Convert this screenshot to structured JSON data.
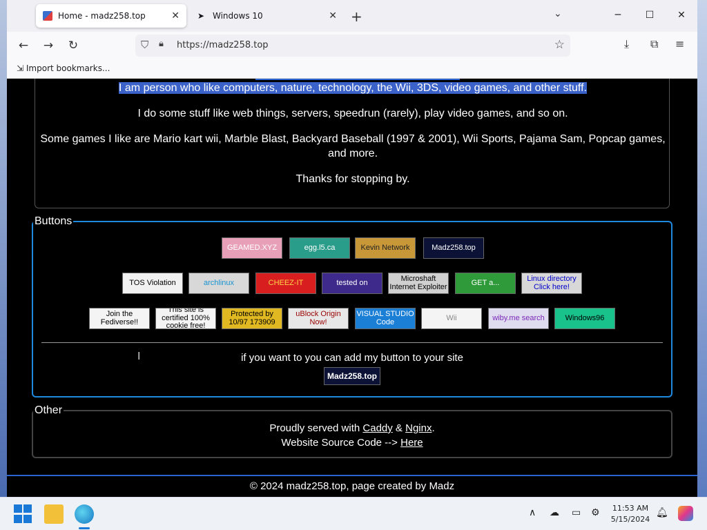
{
  "browser": {
    "tabs": [
      {
        "title": "Home - madz258.top",
        "active": true
      },
      {
        "title": "Windows 10",
        "active": false
      }
    ],
    "new_tab": "+",
    "tab_close": "✕",
    "url": "https://madz258.top",
    "bookmark": "Import bookmarks..."
  },
  "page": {
    "intro_line": "I am person who like computers, nature, technology, the Wii, 3DS, video games, and other stuff.",
    "stuff_line": "I do some stuff like web things, servers, speedrun (rarely), play video games, and so on.",
    "games_line1": "Some games I like are Mario kart wii, Marble Blast, Backyard Baseball (1997 & 2001), Wii Sports, Pajama Sam, Popcap games,",
    "games_line2": "and more.",
    "thanks_line": "Thanks for stopping by.",
    "buttons_legend": "Buttons",
    "badges": [
      {
        "text": "GEAMED.XYZ",
        "bg": "#e8a0b8",
        "fg": "#fff"
      },
      {
        "text": "egg.l5.ca",
        "bg": "#2a9c8a",
        "fg": "#fff"
      },
      {
        "text": "Kevin Network",
        "bg": "#c89838",
        "fg": "#222"
      },
      {
        "text": "Madz258.top",
        "bg": "#0c1236",
        "fg": "#fff"
      },
      {
        "text": "TOS Violation",
        "bg": "#f2f2f2",
        "fg": "#000"
      },
      {
        "text": "archlinux",
        "bg": "#d8d8d8",
        "fg": "#1793d1"
      },
      {
        "text": "CHEEZ-IT",
        "bg": "#d81e1e",
        "fg": "#ffd54a"
      },
      {
        "text": "tested on",
        "bg": "#3d2a8a",
        "fg": "#fff"
      },
      {
        "text": "Microshaft Internet Exploiter",
        "bg": "#d0d0d0",
        "fg": "#000"
      },
      {
        "text": "GET a...",
        "bg": "#2e9a3a",
        "fg": "#fff"
      },
      {
        "text": "Linux directory Click here!",
        "bg": "#d8d8d8",
        "fg": "#0000cc"
      },
      {
        "text": "Join the Fediverse!!",
        "bg": "#f4f4f4",
        "fg": "#000"
      },
      {
        "text": "This site is certified 100% cookie free!",
        "bg": "#f4f4f4",
        "fg": "#000"
      },
      {
        "text": "Protected by 10/97 173909",
        "bg": "#e0b822",
        "fg": "#000"
      },
      {
        "text": "uBlock Origin Now!",
        "bg": "#e8e8e8",
        "fg": "#900"
      },
      {
        "text": "VISUAL STUDIO Code",
        "bg": "#1b7fd6",
        "fg": "#fff"
      },
      {
        "text": "Wii",
        "bg": "#f4f4f4",
        "fg": "#888"
      },
      {
        "text": "wiby.me search",
        "bg": "#e0dcf0",
        "fg": "#7a28b8"
      },
      {
        "text": "Windows96",
        "bg": "#18c28a",
        "fg": "#000"
      }
    ],
    "add_button_text": "if you want to you can add my button to your site",
    "own_button": "Madz258.top",
    "other_legend": "Other",
    "served_prefix": "Proudly served with ",
    "caddy": "Caddy",
    "amp": " & ",
    "nginx": "Nginx",
    "period": ".",
    "source_prefix": "Website Source Code --> ",
    "source_link": "Here",
    "footer": "© 2024 madz258.top, page created by Madz"
  },
  "taskbar": {
    "time": "11:53 AM",
    "date": "5/15/2024"
  }
}
